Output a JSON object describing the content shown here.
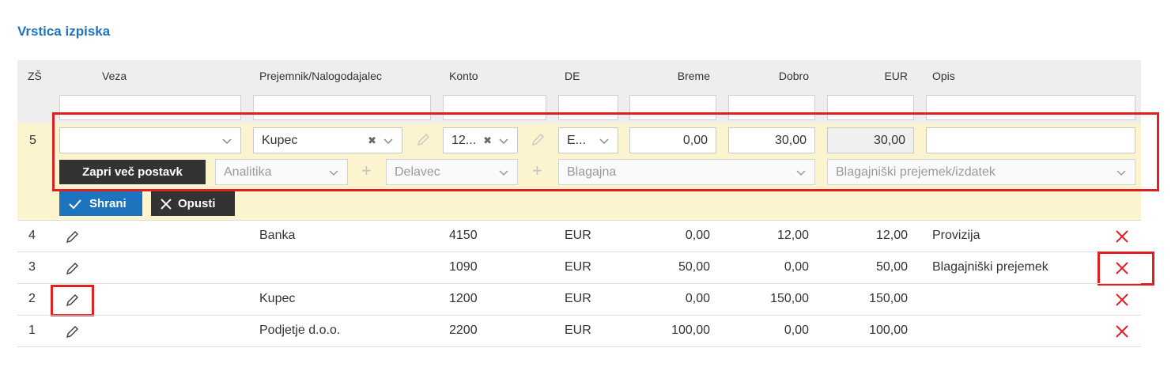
{
  "section_title": "Vrstica izpiska",
  "columns": {
    "zs": "ZŠ",
    "veza": "Veza",
    "prejemnik": "Prejemnik/Nalogodajalec",
    "konto": "Konto",
    "de": "DE",
    "breme": "Breme",
    "dobro": "Dobro",
    "eur": "EUR",
    "opis": "Opis"
  },
  "edit_row": {
    "zs": "5",
    "veza": "",
    "prejemnik": "Kupec",
    "konto": "12...",
    "de": "E...",
    "breme": "0,00",
    "dobro": "30,00",
    "eur": "30,00",
    "opis": "",
    "close_button": "Zapri več postavk",
    "analitika_placeholder": "Analitika",
    "delavec_placeholder": "Delavec",
    "blagajna_placeholder": "Blagajna",
    "prejemek_placeholder": "Blagajniški prejemek/izdatek",
    "save_button": "Shrani",
    "cancel_button": "Opusti"
  },
  "rows": [
    {
      "zs": "4",
      "prejemnik": "Banka",
      "konto": "4150",
      "de": "EUR",
      "breme": "0,00",
      "dobro": "12,00",
      "eur": "12,00",
      "opis": "Provizija"
    },
    {
      "zs": "3",
      "prejemnik": "",
      "konto": "1090",
      "de": "EUR",
      "breme": "50,00",
      "dobro": "0,00",
      "eur": "50,00",
      "opis": "Blagajniški prejemek"
    },
    {
      "zs": "2",
      "prejemnik": "Kupec",
      "konto": "1200",
      "de": "EUR",
      "breme": "0,00",
      "dobro": "150,00",
      "eur": "150,00",
      "opis": ""
    },
    {
      "zs": "1",
      "prejemnik": "Podjetje d.o.o.",
      "konto": "2200",
      "de": "EUR",
      "breme": "100,00",
      "dobro": "0,00",
      "eur": "100,00",
      "opis": ""
    }
  ],
  "colors": {
    "accent": "#1e73be",
    "highlight": "#e02020",
    "edit_row_bg": "#fcf3cf",
    "delete_icon": "#e02020"
  }
}
